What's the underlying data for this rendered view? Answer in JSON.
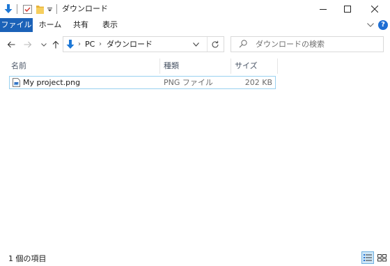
{
  "window": {
    "title": "ダウンロード",
    "controls": [
      "minimize",
      "maximize",
      "close"
    ]
  },
  "ribbon": {
    "tabs": [
      {
        "label": "ファイル",
        "active": true
      },
      {
        "label": "ホーム"
      },
      {
        "label": "共有"
      },
      {
        "label": "表示"
      }
    ],
    "help_label": "?"
  },
  "address": {
    "crumbs": [
      "PC",
      "ダウンロード"
    ]
  },
  "search": {
    "placeholder": "ダウンロードの検索"
  },
  "columns": {
    "name": "名前",
    "type": "種類",
    "size": "サイズ"
  },
  "files": [
    {
      "name": "My project.png",
      "type": "PNG ファイル",
      "size": "202 KB"
    }
  ],
  "statusbar": {
    "count": "1 個の項目"
  },
  "colors": {
    "accent": "#1b62b8",
    "selection_border": "#99d1f0",
    "folder": "#e8b33a",
    "download_arrow": "#1e78d6"
  }
}
